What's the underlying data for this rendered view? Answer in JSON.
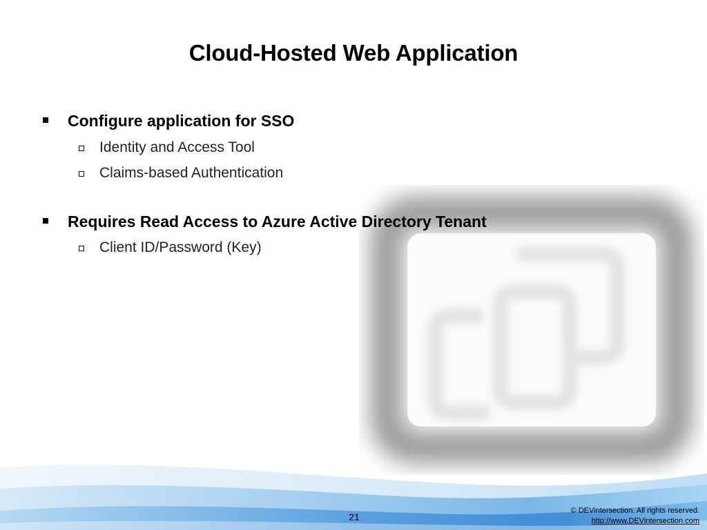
{
  "slide": {
    "title": "Cloud-Hosted Web Application",
    "bullets": [
      {
        "text": "Configure application for SSO",
        "sub": [
          "Identity and Access Tool",
          "Claims-based Authentication"
        ]
      },
      {
        "text": "Requires Read Access to Azure Active Directory Tenant",
        "sub": [
          "Client ID/Password (Key)"
        ]
      }
    ]
  },
  "footer": {
    "page_number": "21",
    "copyright": "© DEVintersection. All rights reserved.",
    "link": "http://www.DEVintersection.com"
  },
  "colors": {
    "wave_light": "#e6f2fb",
    "wave_mid": "#9cc8ee",
    "wave_dark": "#3f8fd8",
    "watermark_gray": "#9a9a9a"
  }
}
